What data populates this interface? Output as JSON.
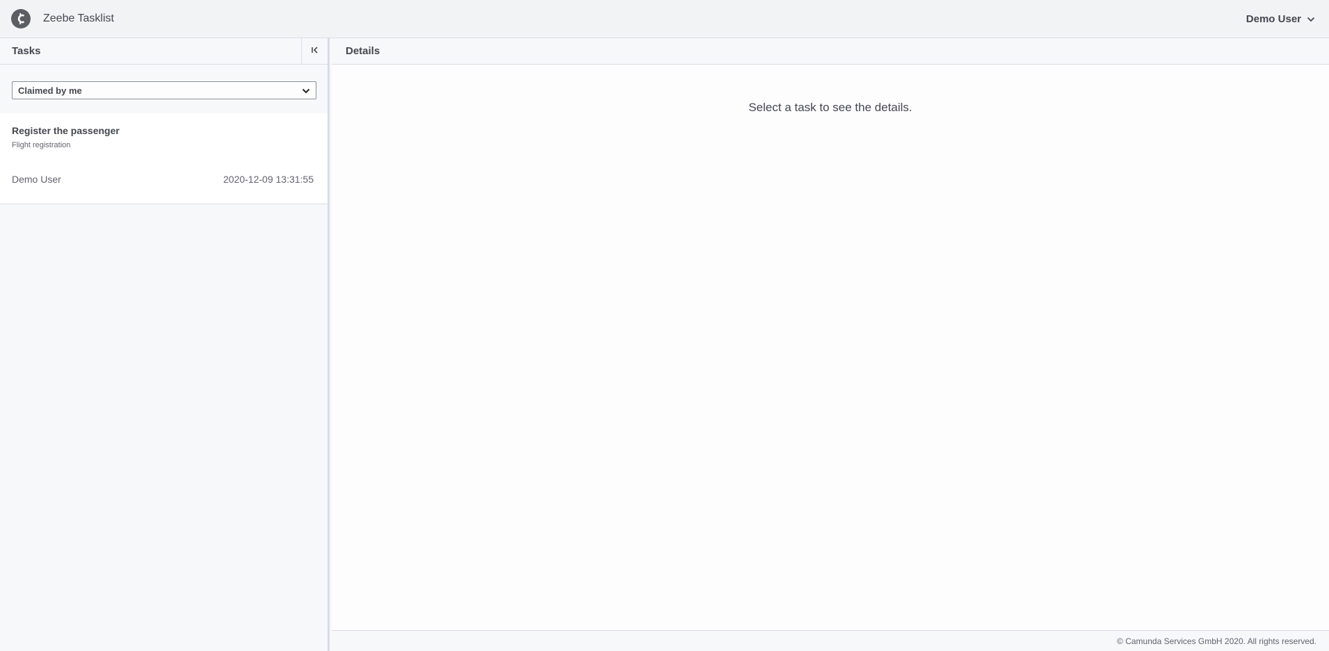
{
  "header": {
    "app_title": "Zeebe Tasklist",
    "logo_icon": "camunda-logo-icon",
    "user_name": "Demo User",
    "user_menu_icon": "chevron-down-icon"
  },
  "tasks_panel": {
    "title": "Tasks",
    "collapse_icon": "collapse-left-icon",
    "filter": {
      "selected": "Claimed by me"
    },
    "tasks": [
      {
        "name": "Register the passenger",
        "process": "Flight registration",
        "assignee": "Demo User",
        "created": "2020-12-09 13:31:55"
      }
    ]
  },
  "details_panel": {
    "title": "Details",
    "empty_message": "Select a task to see the details."
  },
  "footer": {
    "copyright": "© Camunda Services GmbH 2020. All rights reserved."
  }
}
